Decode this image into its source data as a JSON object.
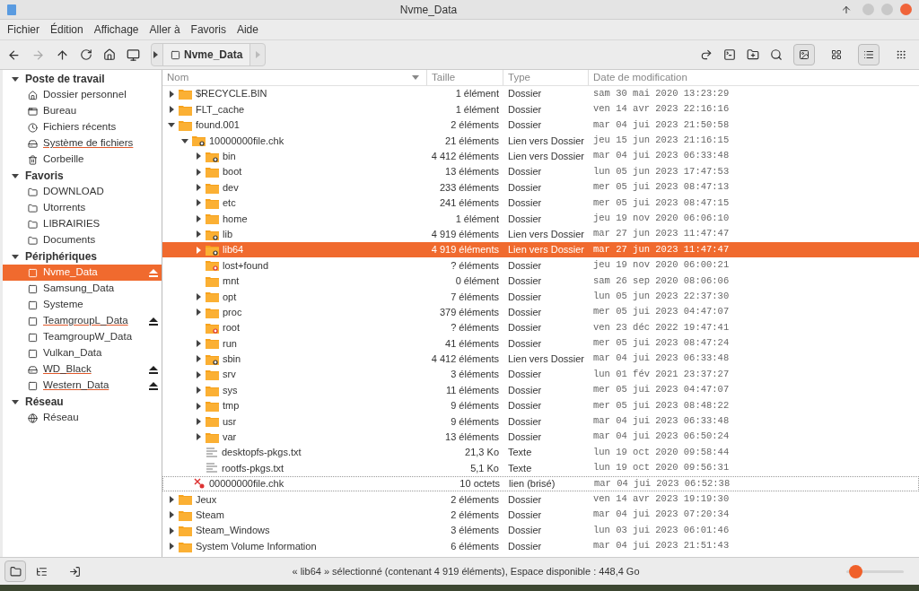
{
  "window": {
    "title": "Nvme_Data"
  },
  "menu": [
    "Fichier",
    "Édition",
    "Affichage",
    "Aller à",
    "Favoris",
    "Aide"
  ],
  "location": {
    "label": "Nvme_Data"
  },
  "view_buttons": [
    {
      "kind": "preview",
      "selected": true
    },
    {
      "kind": "icons",
      "selected": false
    },
    {
      "kind": "list",
      "selected": true
    },
    {
      "kind": "compact",
      "selected": false
    }
  ],
  "sidebar": [
    {
      "label": "Poste de travail",
      "expanded": true,
      "items": [
        {
          "label": "Dossier personnel",
          "kind": "home",
          "selected": false,
          "underlined": false,
          "ejectable": false
        },
        {
          "label": "Bureau",
          "kind": "desktop",
          "selected": false,
          "underlined": false,
          "ejectable": false
        },
        {
          "label": "Fichiers récents",
          "kind": "recent",
          "selected": false,
          "underlined": false,
          "ejectable": false
        },
        {
          "label": "Système de fichiers",
          "kind": "filesystem",
          "selected": false,
          "underlined": true,
          "ejectable": false
        },
        {
          "label": "Corbeille",
          "kind": "trash",
          "selected": false,
          "underlined": false,
          "ejectable": false
        }
      ]
    },
    {
      "label": "Favoris",
      "expanded": true,
      "items": [
        {
          "label": "DOWNLOAD",
          "kind": "folder",
          "selected": false,
          "underlined": false,
          "ejectable": false
        },
        {
          "label": "Utorrents",
          "kind": "folder",
          "selected": false,
          "underlined": false,
          "ejectable": false
        },
        {
          "label": "LIBRAIRIES",
          "kind": "folder",
          "selected": false,
          "underlined": false,
          "ejectable": false
        },
        {
          "label": "Documents",
          "kind": "folder",
          "selected": false,
          "underlined": false,
          "ejectable": false
        }
      ]
    },
    {
      "label": "Périphériques",
      "expanded": true,
      "items": [
        {
          "label": "Nvme_Data",
          "kind": "drive",
          "selected": true,
          "underlined": false,
          "ejectable": true
        },
        {
          "label": "Samsung_Data",
          "kind": "drive",
          "selected": false,
          "underlined": false,
          "ejectable": false
        },
        {
          "label": "Systeme",
          "kind": "drive",
          "selected": false,
          "underlined": false,
          "ejectable": false
        },
        {
          "label": "TeamgroupL_Data",
          "kind": "drive",
          "selected": false,
          "underlined": true,
          "ejectable": true
        },
        {
          "label": "TeamgroupW_Data",
          "kind": "drive",
          "selected": false,
          "underlined": false,
          "ejectable": false
        },
        {
          "label": "Vulkan_Data",
          "kind": "drive",
          "selected": false,
          "underlined": false,
          "ejectable": false
        },
        {
          "label": "WD_Black",
          "kind": "filesystem",
          "selected": false,
          "underlined": true,
          "ejectable": true
        },
        {
          "label": "Western_Data",
          "kind": "drive",
          "selected": false,
          "underlined": true,
          "ejectable": true
        }
      ]
    },
    {
      "label": "Réseau",
      "expanded": true,
      "items": [
        {
          "label": "Réseau",
          "kind": "network",
          "selected": false,
          "underlined": false,
          "ejectable": false
        }
      ]
    }
  ],
  "table": {
    "columns": [
      "Nom",
      "Taille",
      "Type",
      "Date de modification"
    ],
    "rows": [
      {
        "name": "$RECYCLE.BIN",
        "size": "1 élément",
        "type": "Dossier",
        "date": "sam 30 mai 2020 13:23:29",
        "kind": "folder",
        "expanded": false,
        "selected": false,
        "focused": false
      },
      {
        "name": "FLT_cache",
        "size": "1 élément",
        "type": "Dossier",
        "date": "ven 14 avr 2023 22:16:16",
        "kind": "folder",
        "expanded": false,
        "selected": false,
        "focused": false
      },
      {
        "name": "found.001",
        "size": "2 éléments",
        "type": "Dossier",
        "date": "mar 04 jui 2023 21:50:58",
        "kind": "folder",
        "expanded": true,
        "selected": false,
        "focused": false,
        "children": [
          {
            "name": "10000000file.chk",
            "size": "21 éléments",
            "type": "Lien vers Dossier",
            "date": "jeu 15 jun 2023 21:16:15",
            "kind": "link",
            "expanded": true,
            "selected": false,
            "focused": false,
            "children": [
              {
                "name": "bin",
                "size": "4 412 éléments",
                "type": "Lien vers Dossier",
                "date": "mar 04 jui 2023 06:33:48",
                "kind": "link",
                "expanded": false,
                "selected": false,
                "focused": false
              },
              {
                "name": "boot",
                "size": "13 éléments",
                "type": "Dossier",
                "date": "lun 05 jun 2023 17:47:53",
                "kind": "folder",
                "expanded": false,
                "selected": false,
                "focused": false
              },
              {
                "name": "dev",
                "size": "233 éléments",
                "type": "Dossier",
                "date": "mer 05 jui 2023 08:47:13",
                "kind": "folder",
                "expanded": false,
                "selected": false,
                "focused": false
              },
              {
                "name": "etc",
                "size": "241 éléments",
                "type": "Dossier",
                "date": "mer 05 jui 2023 08:47:15",
                "kind": "folder",
                "expanded": false,
                "selected": false,
                "focused": false
              },
              {
                "name": "home",
                "size": "1 élément",
                "type": "Dossier",
                "date": "jeu 19 nov 2020 06:06:10",
                "kind": "folder",
                "expanded": false,
                "selected": false,
                "focused": false
              },
              {
                "name": "lib",
                "size": "4 919 éléments",
                "type": "Lien vers Dossier",
                "date": "mar 27 jun 2023 11:47:47",
                "kind": "link",
                "expanded": false,
                "selected": false,
                "focused": false
              },
              {
                "name": "lib64",
                "size": "4 919 éléments",
                "type": "Lien vers Dossier",
                "date": "mar 27 jun 2023 11:47:47",
                "kind": "link",
                "expanded": false,
                "selected": true,
                "focused": false
              },
              {
                "name": "lost+found",
                "size": "? éléments",
                "type": "Dossier",
                "date": "jeu 19 nov 2020 06:00:21",
                "kind": "locked",
                "selected": false,
                "focused": false
              },
              {
                "name": "mnt",
                "size": "0 élément",
                "type": "Dossier",
                "date": "sam 26 sep 2020 08:06:06",
                "kind": "folder",
                "selected": false,
                "focused": false
              },
              {
                "name": "opt",
                "size": "7 éléments",
                "type": "Dossier",
                "date": "lun 05 jun 2023 22:37:30",
                "kind": "folder",
                "expanded": false,
                "selected": false,
                "focused": false
              },
              {
                "name": "proc",
                "size": "379 éléments",
                "type": "Dossier",
                "date": "mer 05 jui 2023 04:47:07",
                "kind": "folder",
                "expanded": false,
                "selected": false,
                "focused": false
              },
              {
                "name": "root",
                "size": "? éléments",
                "type": "Dossier",
                "date": "ven 23 déc 2022 19:47:41",
                "kind": "locked",
                "selected": false,
                "focused": false
              },
              {
                "name": "run",
                "size": "41 éléments",
                "type": "Dossier",
                "date": "mer 05 jui 2023 08:47:24",
                "kind": "folder",
                "expanded": false,
                "selected": false,
                "focused": false
              },
              {
                "name": "sbin",
                "size": "4 412 éléments",
                "type": "Lien vers Dossier",
                "date": "mar 04 jui 2023 06:33:48",
                "kind": "link",
                "expanded": false,
                "selected": false,
                "focused": false
              },
              {
                "name": "srv",
                "size": "3 éléments",
                "type": "Dossier",
                "date": "lun 01 fév 2021 23:37:27",
                "kind": "folder",
                "expanded": false,
                "selected": false,
                "focused": false
              },
              {
                "name": "sys",
                "size": "11 éléments",
                "type": "Dossier",
                "date": "mer 05 jui 2023 04:47:07",
                "kind": "folder",
                "expanded": false,
                "selected": false,
                "focused": false
              },
              {
                "name": "tmp",
                "size": "9 éléments",
                "type": "Dossier",
                "date": "mer 05 jui 2023 08:48:22",
                "kind": "folder",
                "expanded": false,
                "selected": false,
                "focused": false
              },
              {
                "name": "usr",
                "size": "9 éléments",
                "type": "Dossier",
                "date": "mar 04 jui 2023 06:33:48",
                "kind": "folder",
                "expanded": false,
                "selected": false,
                "focused": false
              },
              {
                "name": "var",
                "size": "13 éléments",
                "type": "Dossier",
                "date": "mar 04 jui 2023 06:50:24",
                "kind": "folder",
                "expanded": false,
                "selected": false,
                "focused": false
              },
              {
                "name": "desktopfs-pkgs.txt",
                "size": "21,3 Ko",
                "type": "Texte",
                "date": "lun 19 oct 2020 09:58:44",
                "kind": "text",
                "selected": false,
                "focused": false
              },
              {
                "name": "rootfs-pkgs.txt",
                "size": "5,1 Ko",
                "type": "Texte",
                "date": "lun 19 oct 2020 09:56:31",
                "kind": "text",
                "selected": false,
                "focused": false
              }
            ]
          },
          {
            "name": "00000000file.chk",
            "size": "10 octets",
            "type": "lien (brisé)",
            "date": "mar 04 jui 2023 06:52:38",
            "kind": "broken",
            "selected": false,
            "focused": true
          }
        ]
      },
      {
        "name": "Jeux",
        "size": "2 éléments",
        "type": "Dossier",
        "date": "ven 14 avr 2023 19:19:30",
        "kind": "folder",
        "expanded": false,
        "selected": false,
        "focused": false
      },
      {
        "name": "Steam",
        "size": "2 éléments",
        "type": "Dossier",
        "date": "mar 04 jui 2023 07:20:34",
        "kind": "folder",
        "expanded": false,
        "selected": false,
        "focused": false
      },
      {
        "name": "Steam_Windows",
        "size": "3 éléments",
        "type": "Dossier",
        "date": "lun 03 jui 2023 06:01:46",
        "kind": "folder",
        "expanded": false,
        "selected": false,
        "focused": false
      },
      {
        "name": "System Volume Information",
        "size": "6 éléments",
        "type": "Dossier",
        "date": "mar 04 jui 2023 21:51:43",
        "kind": "folder",
        "expanded": false,
        "selected": false,
        "focused": false
      }
    ]
  },
  "status_bar": {
    "text": "« lib64 » sélectionné (contenant 4 919 éléments), Espace disponible : 448,4 Go",
    "zoom": {
      "level": 0.05
    }
  }
}
